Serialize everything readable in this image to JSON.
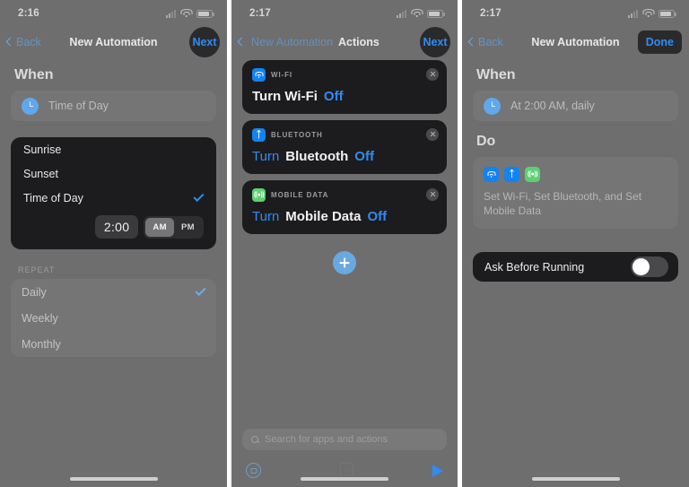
{
  "panel1": {
    "status": {
      "time": "2:16",
      "icons": [
        "cellular-icon",
        "wifi-icon",
        "battery-icon"
      ]
    },
    "nav": {
      "back_label": "Back",
      "title": "New Automation",
      "action_label": "Next"
    },
    "section_when": "When",
    "trigger_row": {
      "icon": "clock-icon",
      "label": "Time of Day"
    },
    "dropdown": {
      "options": [
        {
          "label": "Sunrise",
          "selected": false
        },
        {
          "label": "Sunset",
          "selected": false
        },
        {
          "label": "Time of Day",
          "selected": true
        }
      ],
      "time_value": "2:00",
      "meridiem": [
        {
          "label": "AM",
          "selected": true
        },
        {
          "label": "PM",
          "selected": false
        }
      ]
    },
    "repeat": {
      "header": "REPEAT",
      "options": [
        {
          "label": "Daily",
          "selected": true
        },
        {
          "label": "Weekly",
          "selected": false
        },
        {
          "label": "Monthly",
          "selected": false
        }
      ]
    }
  },
  "panel2": {
    "status": {
      "time": "2:17"
    },
    "nav": {
      "back_label": "New Automation",
      "title": "Actions",
      "action_label": "Next"
    },
    "actions": [
      {
        "icon": "wifi-app-icon",
        "kicker": "WI-FI",
        "parts": [
          {
            "text": "Turn Wi-Fi",
            "style": "plain"
          },
          {
            "text": "Off",
            "style": "var"
          }
        ],
        "remove": "remove-action-icon"
      },
      {
        "icon": "bluetooth-app-icon",
        "kicker": "BLUETOOTH",
        "parts": [
          {
            "text": "Turn",
            "style": "verb-blue"
          },
          {
            "text": "Bluetooth",
            "style": "plain"
          },
          {
            "text": "Off",
            "style": "var"
          }
        ],
        "remove": "remove-action-icon"
      },
      {
        "icon": "mobile-data-app-icon",
        "kicker": "MOBILE DATA",
        "parts": [
          {
            "text": "Turn",
            "style": "verb-blue"
          },
          {
            "text": "Mobile Data",
            "style": "plain"
          },
          {
            "text": "Off",
            "style": "var"
          }
        ],
        "remove": "remove-action-icon"
      }
    ],
    "add_button": "add-action-button",
    "search_placeholder": "Search for apps and actions",
    "toolbar": [
      "shortcuts-icon",
      "notes-icon",
      "play-icon"
    ]
  },
  "panel3": {
    "status": {
      "time": "2:17"
    },
    "nav": {
      "back_label": "Back",
      "title": "New Automation",
      "action_label": "Done"
    },
    "section_when": "When",
    "trigger_row": {
      "icon": "clock-icon",
      "label": "At 2:00 AM, daily"
    },
    "section_do": "Do",
    "do_card": {
      "icons": [
        "wifi-app-icon",
        "bluetooth-app-icon",
        "mobile-data-app-icon"
      ],
      "description": "Set Wi-Fi, Set Bluetooth, and Set Mobile Data"
    },
    "ask_before_running": {
      "label": "Ask Before Running",
      "state": "off"
    }
  },
  "colors": {
    "accent_blue": "#2f8cf5",
    "card_dark": "#1c1c1e",
    "screen_overlay": "#6e6e6e",
    "green": "#5cd073"
  }
}
